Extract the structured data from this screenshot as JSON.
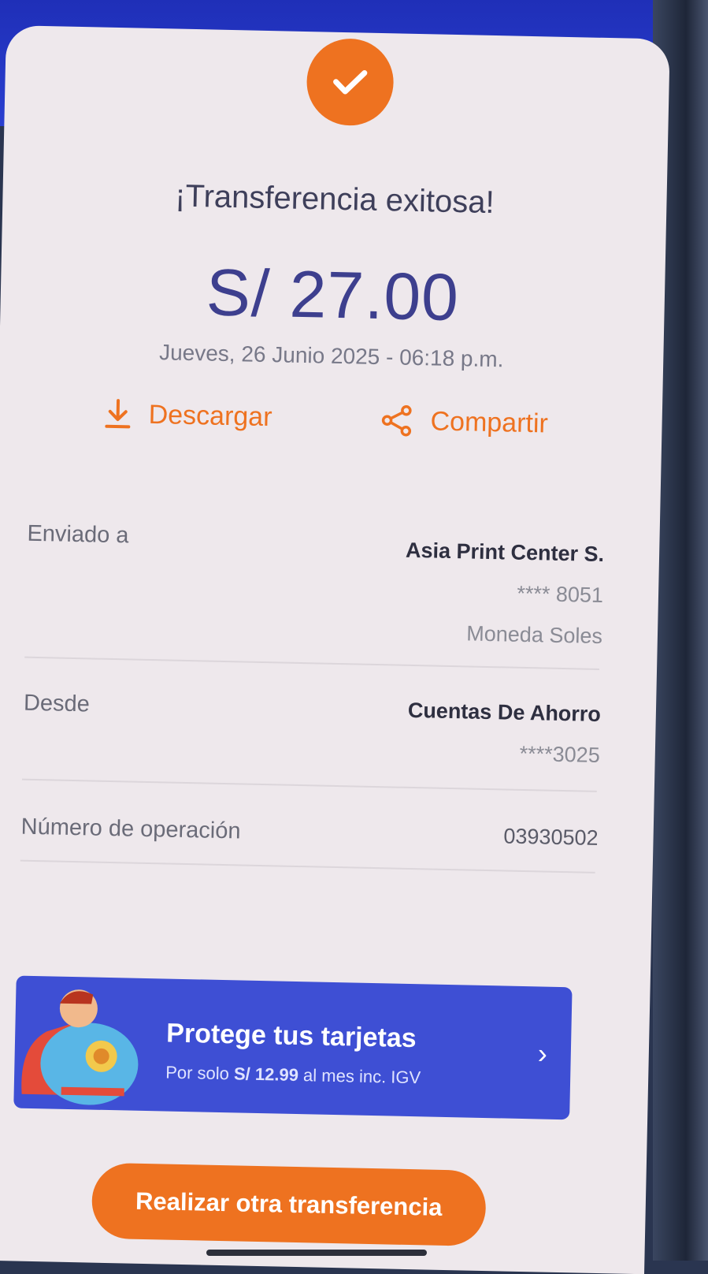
{
  "receipt": {
    "status_title": "¡Transferencia exitosa!",
    "amount": "S/ 27.00",
    "datetime": "Jueves, 26 Junio 2025 - 06:18 p.m.",
    "icon": "check-icon"
  },
  "actions": {
    "download_label": "Descargar",
    "download_icon": "download-icon",
    "share_label": "Compartir",
    "share_icon": "share-icon"
  },
  "details": {
    "sent_to": {
      "label": "Enviado a",
      "name": "Asia Print Center S.",
      "account": "**** 8051",
      "currency": "Moneda Soles"
    },
    "from": {
      "label": "Desde",
      "account_type": "Cuentas De Ahorro",
      "account": "****3025"
    },
    "operation": {
      "label": "Número de operación",
      "value": "03930502"
    }
  },
  "promo": {
    "title": "Protege tus tarjetas",
    "subtitle_prefix": "Por solo ",
    "subtitle_price": "S/ 12.99",
    "subtitle_suffix": " al mes inc. IGV",
    "chevron": "›"
  },
  "cta": {
    "label": "Realizar otra transferencia"
  },
  "colors": {
    "accent": "#ee7220",
    "amount": "#3d3f8e",
    "promo_bg": "#3e4fd4"
  }
}
